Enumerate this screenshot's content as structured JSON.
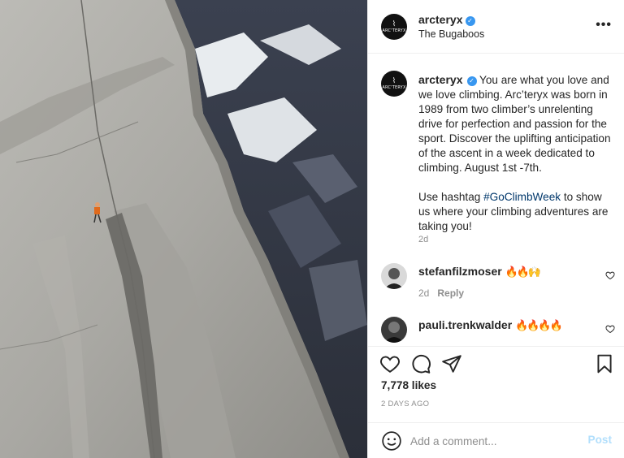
{
  "post": {
    "username": "arcteryx",
    "location": "The Bugaboos",
    "avatar_logo": "ARC'TERYX",
    "more_icon": "•••",
    "verified_mark": "✓"
  },
  "caption": {
    "username": "arcteryx",
    "text_para1": "You are what you love and we love climbing. Arc’teryx was born in 1989 from two climber’s unrelenting drive for perfection and passion for the sport. Discover the uplifting anticipation of the ascent in a week dedicated to climbing. August 1st -7th.",
    "text_para2_before": "Use hashtag ",
    "hashtag": "#GoClimbWeek",
    "text_para2_after": " to show us where your climbing adventures are taking you!",
    "time": "2d"
  },
  "comments": [
    {
      "username": "stefanfilzmoser",
      "text": "🔥🔥🙌",
      "time": "2d",
      "reply_label": "Reply"
    },
    {
      "username": "pauli.trenkwalder",
      "text": "🔥🔥🔥🔥"
    }
  ],
  "actions": {
    "likes": "7,778 likes",
    "posted": "2 DAYS AGO"
  },
  "add_comment": {
    "placeholder": "Add a comment...",
    "post_label": "Post"
  },
  "colors": {
    "accent": "#3897f0",
    "hashtag": "#00376b",
    "post_disabled": "#b2dffc",
    "secondary_text": "#8e8e8e"
  },
  "icons": [
    "photo",
    "verified-icon",
    "more-options-icon",
    "heart-icon",
    "comment-icon",
    "share-icon",
    "bookmark-icon",
    "emoji-icon"
  ]
}
